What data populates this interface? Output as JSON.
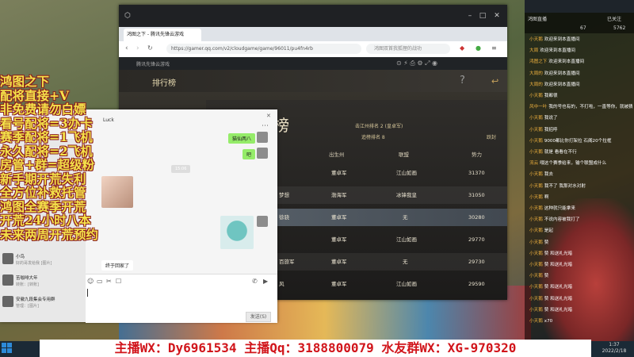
{
  "promo_lines": [
    "鸿图之下",
    "配将直接+V",
    "非免费请勿白嫖",
    "看号配将=3办卡",
    "赛季配将=1飞机",
    "永久配将=2飞机",
    "房管+群=超级粉",
    "新手期开荒失利",
    "全方位补救托管",
    "鸿图全赛季开荒",
    "开荒24小时八本",
    "未来两周开荒预约"
  ],
  "banner": "主播WX：Dy6961534 主播Qq：3188800079 水友群WX：XG-970320",
  "browser": {
    "tab_label": "鸿图之下 - 腾讯先锋云游戏",
    "url": "https://gamer.qq.com/v2/cloudgame/game/96011/pu4fn4rb",
    "search_placeholder": "鸿图双首我狐狸的战功",
    "game_toolbar_label": "腾讯先锋云游戏"
  },
  "game": {
    "panel_title": "排行榜",
    "board_title": "榜",
    "subtab1": "击江州排名 2 (皇卓军)",
    "subtab2": "追榜排名 8",
    "subtab3": "跃封",
    "columns": [
      "出生州",
      "联盟",
      "势力"
    ],
    "rows": [
      {
        "name": "",
        "state": "董卓军",
        "alliance": "江山如画",
        "power": "31370"
      },
      {
        "name": "梦想",
        "state": "渤海军",
        "alliance": "冰锋我皇",
        "power": "31050"
      },
      {
        "name": "徐骁",
        "state": "董卓军",
        "alliance": "无",
        "power": "30280"
      },
      {
        "name": "",
        "state": "董卓军",
        "alliance": "江山如画",
        "power": "29770"
      },
      {
        "name": "百旅军",
        "state": "董卓军",
        "alliance": "无",
        "power": "29730"
      },
      {
        "name": "风",
        "state": "董卓军",
        "alliance": "江山如画",
        "power": "29590"
      }
    ]
  },
  "chat": {
    "header_tag": "Luck",
    "messages": [
      {
        "side": "right",
        "text": "猫仙两八"
      },
      {
        "side": "right",
        "text": "吧"
      },
      {
        "side": "center",
        "text": "15:06"
      },
      {
        "side": "left",
        "text": "终于回家了"
      }
    ],
    "contacts": [
      {
        "name": "小鸟",
        "sub": "好的哥发给我 [图片]"
      },
      {
        "name": "苦咖啡大年",
        "sub": "转账：[转账]"
      },
      {
        "name": "安徽九段集会专用群",
        "sub": "管理：[图片]"
      }
    ],
    "send_label": "发送(S)"
  },
  "right_panel": {
    "header_left": "鸿图直播",
    "header_right": "已关注",
    "counts": [
      "67",
      "5762"
    ],
    "messages": [
      {
        "name": "小天鹅",
        "text": "欢迎来到本直播间"
      },
      {
        "name": "大周",
        "text": "欢迎来到本直播间"
      },
      {
        "name": "鸿图之下",
        "text": "欢迎来到本直播间"
      },
      {
        "name": "大周的",
        "text": "欢迎来到本直播间"
      },
      {
        "name": "大周的",
        "text": "欢迎来到本直播间"
      },
      {
        "name": "小天鹅",
        "text": "我都很"
      },
      {
        "name": "风中一叶",
        "text": "我的号也有的，不打啦，一直等你，就被猜了"
      },
      {
        "name": "小天鹅",
        "text": "我说了"
      },
      {
        "name": "小天鹅",
        "text": "我招呼"
      },
      {
        "name": "小天鹅",
        "text": "9000都比你打架拉 石阁20个拉框"
      },
      {
        "name": "小天鹅",
        "text": "就是 看看在不行"
      },
      {
        "name": "流云",
        "text": "哦这个赛季给来，输个联盟成什么"
      },
      {
        "name": "小天鹅",
        "text": "我去"
      },
      {
        "name": "小天鹅",
        "text": "我不了 我那对水对射"
      },
      {
        "name": "小天鹅",
        "text": "啊"
      },
      {
        "name": "小天鹅",
        "text": "这种就只能拿来"
      },
      {
        "name": "小天鹅",
        "text": "不说内容被我打了"
      },
      {
        "name": "小天鹅",
        "text": "是起"
      },
      {
        "name": "小天鹅",
        "text": "赞"
      },
      {
        "name": "小天鹅",
        "text": "赞 和送礼光暗"
      },
      {
        "name": "小天鹅",
        "text": "赞 和送礼光暗"
      },
      {
        "name": "小天鹅",
        "text": "赞"
      },
      {
        "name": "小天鹅",
        "text": "赞 和送礼光暗"
      },
      {
        "name": "小天鹅",
        "text": "赞 和送礼光暗"
      },
      {
        "name": "小天鹅",
        "text": "赞 和送礼光暗"
      },
      {
        "name": "小天鹅",
        "text": "x70"
      }
    ]
  },
  "taskbar": {
    "time": "1:37",
    "date": "2022/2/18"
  }
}
